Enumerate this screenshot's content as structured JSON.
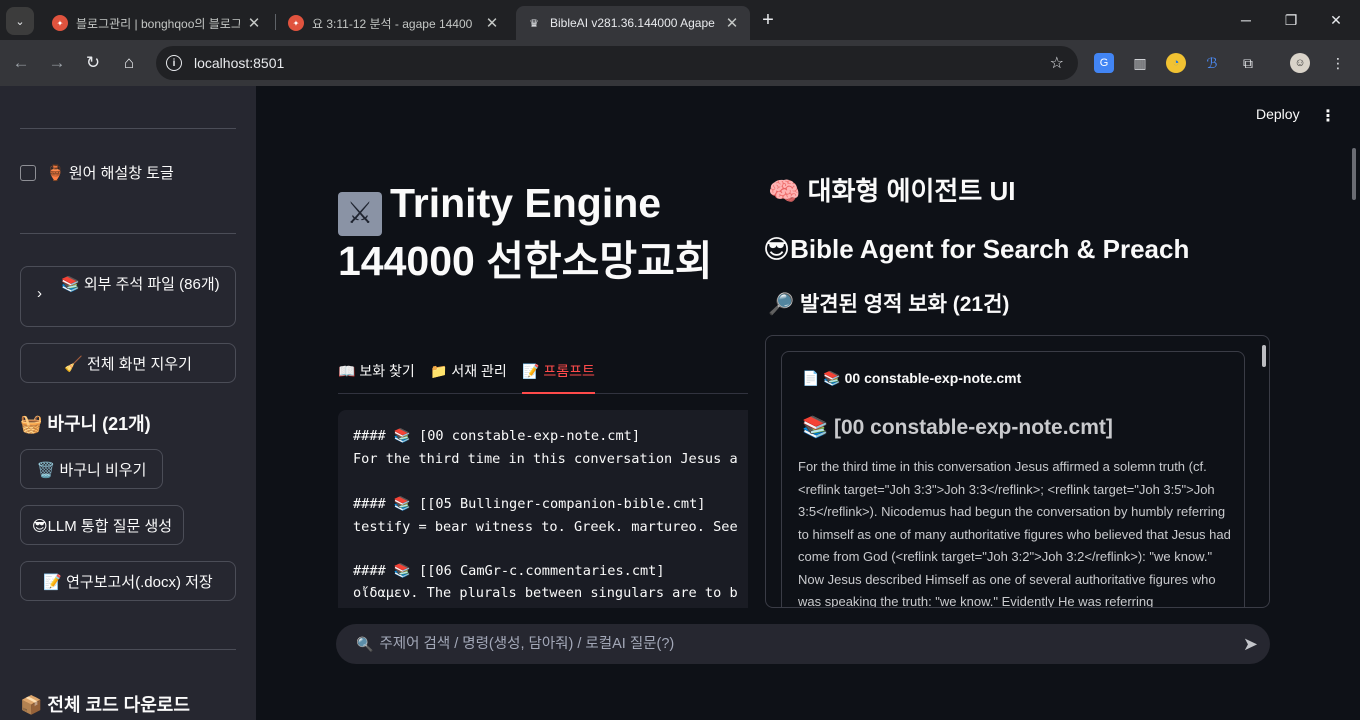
{
  "browser": {
    "tabs": [
      {
        "title": "블로그관리 | bonghqoo의 블로그",
        "icon": "tistory-favicon"
      },
      {
        "title": "요 3:11-12 분석 - agape 14400",
        "icon": "tistory-favicon"
      },
      {
        "title": "BibleAI v281.36.144000 Agape",
        "icon": "streamlit-crown-favicon"
      }
    ],
    "url": "localhost:8501"
  },
  "sidebar": {
    "toggle_label": "🏺 원어 해설창 토글",
    "expander_label": "📚 외부 주석 파일 (86개)",
    "clear_button": "🧹 전체 화면 지우기",
    "basket_header": "🧺 바구니 (21개)",
    "empty_basket_button": "🗑️ 바구니 비우기",
    "llm_button": "😎LLM 통합 질문 생성",
    "report_button": "📝 연구보고서(.docx) 저장",
    "download_header": "📦 전체 코드 다운로드"
  },
  "header": {
    "deploy": "Deploy",
    "menu": "⋮"
  },
  "main": {
    "title": "Trinity Engine 144000 선한소망교회",
    "title_icon": "crossed-swords-emoji",
    "tabs": [
      {
        "label": "📖 보화 찾기"
      },
      {
        "label": "📁 서재 관리"
      },
      {
        "label": "📝 프롬프트"
      }
    ],
    "active_tab": 2,
    "code_lines": [
      "#### 📚 [00 constable-exp-note.cmt]",
      "For the third time in this conversation Jesus a",
      "",
      "#### 📚 [[05 Bullinger-companion-bible.cmt]",
      "testify = bear witness to. Greek. martureo. See",
      "",
      "#### 📚 [[06 CamGr-c.commentaries.cmt]",
      "οἴδαμεν. The plurals between singulars are to b"
    ]
  },
  "right": {
    "h_agent": "🧠 대화형 에이전트 UI",
    "h_bible": "😎Bible Agent for Search & Preach",
    "h_found": "🔎 발견된 영적 보화 (21건)",
    "card_title": "📄 📚 00 constable-exp-note.cmt",
    "card_heading": "📚 [00 constable-exp-note.cmt]",
    "card_body": "For the third time in this conversation Jesus affirmed a solemn truth (cf. <reflink target=\"Joh 3:3\">Joh 3:3</reflink>; <reflink target=\"Joh 3:5\">Joh 3:5</reflink>). Nicodemus had begun the conversation by humbly referring to himself as one of many authoritative figures who believed that Jesus had come from God (<reflink target=\"Joh 3:2\">Joh 3:2</reflink>): \"we know.\" Now Jesus described Himself as one of several authoritative figures who was speaking the truth: \"we know.\" Evidently He was referring"
  },
  "chat": {
    "placeholder": "주제어 검색 / 명령(생성, 담아줘) / 로컬AI 질문(?)"
  }
}
